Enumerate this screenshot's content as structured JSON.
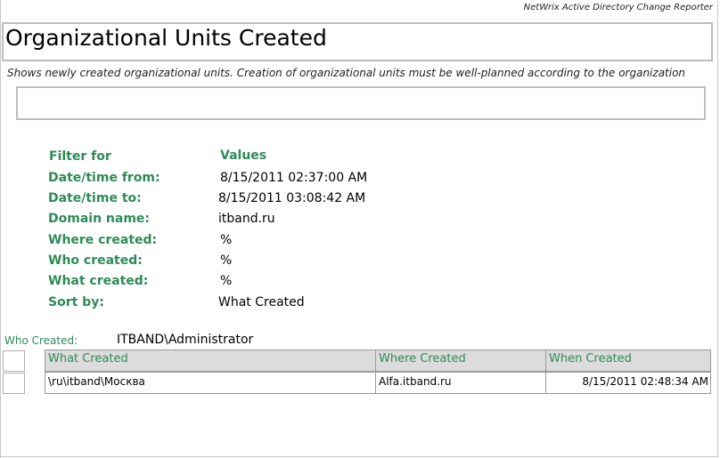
{
  "header": {
    "reporter": "NetWrix Active Directory Change Reporter",
    "title": "Organizational Units Created",
    "description": "Shows newly created organizational units. Creation of organizational units must be well-planned according to the organization"
  },
  "filters": {
    "col_filter": "Filter for",
    "col_values": "Values",
    "rows": [
      {
        "label": "Date/time from:",
        "value": "8/15/2011 02:37:00 AM"
      },
      {
        "label": "Date/time to:",
        "value": "8/15/2011 03:08:42 AM"
      },
      {
        "label": "Domain name:",
        "value": "itband.ru"
      },
      {
        "label": "Where created:",
        "value": "%"
      },
      {
        "label": "Who created:",
        "value": "%"
      },
      {
        "label": "What created:",
        "value": "%"
      },
      {
        "label": "Sort by:",
        "value": "What Created"
      }
    ]
  },
  "group": {
    "label": "Who Created:",
    "value": "ITBAND\\Administrator"
  },
  "table": {
    "headers": [
      "What Created",
      "Where Created",
      "When Created"
    ],
    "rows": [
      [
        "\\ru\\itband\\Москва",
        "Alfa.itband.ru",
        "8/15/2011 02:48:34 AM"
      ]
    ]
  }
}
